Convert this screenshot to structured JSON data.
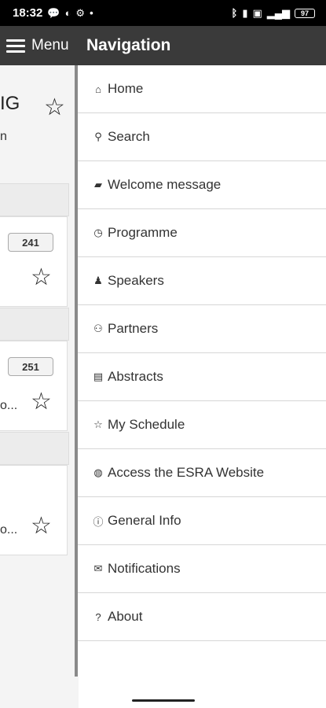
{
  "status_bar": {
    "time": "18:32",
    "battery": "97"
  },
  "header": {
    "menu_label": "Menu",
    "nav_title": "Navigation"
  },
  "background": {
    "title_fragment": "IG",
    "subtitle_fragment": "n",
    "badges": [
      "241",
      "251"
    ],
    "truncated": [
      "o...",
      "o..."
    ]
  },
  "navigation": {
    "items": [
      {
        "label": "Home",
        "icon": "home-icon"
      },
      {
        "label": "Search",
        "icon": "search-icon"
      },
      {
        "label": "Welcome message",
        "icon": "message-icon"
      },
      {
        "label": "Programme",
        "icon": "clock-icon"
      },
      {
        "label": "Speakers",
        "icon": "person-icon"
      },
      {
        "label": "Partners",
        "icon": "people-icon"
      },
      {
        "label": "Abstracts",
        "icon": "document-icon"
      },
      {
        "label": "My Schedule",
        "icon": "star-icon"
      },
      {
        "label": "Access the ESRA Website",
        "icon": "globe-icon"
      },
      {
        "label": "General Info",
        "icon": "info-icon"
      },
      {
        "label": "Notifications",
        "icon": "envelope-icon"
      },
      {
        "label": "About",
        "icon": "question-icon"
      }
    ]
  }
}
